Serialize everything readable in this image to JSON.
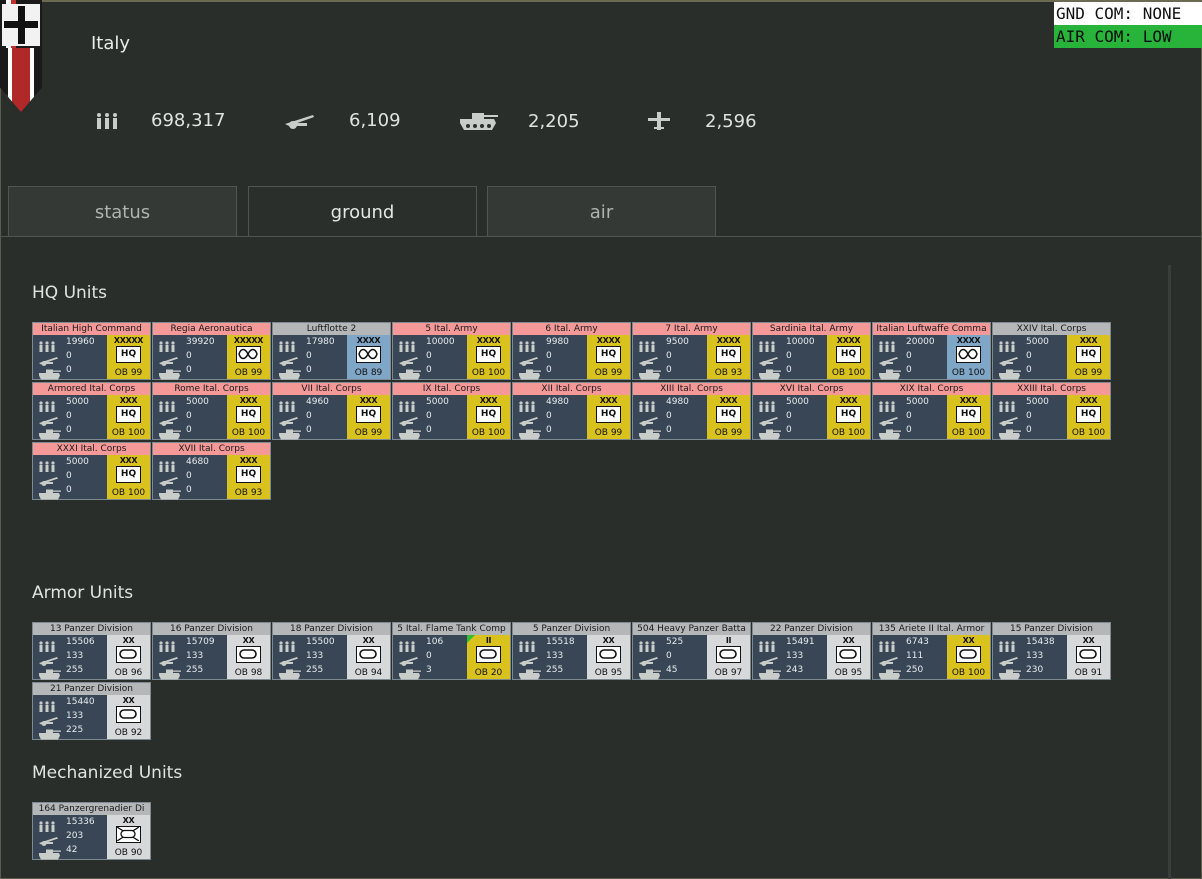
{
  "nation": "Italy",
  "command": {
    "gnd": "GND COM: NONE",
    "air": "AIR COM: LOW"
  },
  "stats": {
    "men": "698,317",
    "guns": "6,109",
    "tanks": "2,205",
    "aircraft": "2,596"
  },
  "tabs": [
    "status",
    "ground",
    "air"
  ],
  "active_tab": "ground",
  "colors": {
    "pink": "#f59898",
    "gray": "#b4b6b8",
    "yellow": "#d9c21e",
    "blue": "#7fa6c6",
    "white": "#d6d8da",
    "air_com": "#28b43a"
  },
  "sections": {
    "hq": {
      "title": "HQ Units",
      "units": [
        {
          "name": "Italian High Command",
          "men": "19960",
          "guns": "0",
          "tanks": "0",
          "echelon": "XXXXX",
          "sym": "HQ",
          "ob": "OB 99",
          "head": "pink",
          "badge": "yellow"
        },
        {
          "name": "Regia Aeronautica",
          "men": "39920",
          "guns": "0",
          "tanks": "0",
          "echelon": "XXXXX",
          "sym": "air",
          "ob": "OB 99",
          "head": "pink",
          "badge": "yellow"
        },
        {
          "name": "Luftflotte 2",
          "men": "17980",
          "guns": "0",
          "tanks": "0",
          "echelon": "XXXX",
          "sym": "air",
          "ob": "OB 89",
          "head": "gray",
          "badge": "blue"
        },
        {
          "name": "5 Ital. Army",
          "men": "10000",
          "guns": "0",
          "tanks": "0",
          "echelon": "XXXX",
          "sym": "HQ",
          "ob": "OB 100",
          "head": "pink",
          "badge": "yellow"
        },
        {
          "name": "6 Ital. Army",
          "men": "9980",
          "guns": "0",
          "tanks": "0",
          "echelon": "XXXX",
          "sym": "HQ",
          "ob": "OB 99",
          "head": "pink",
          "badge": "yellow"
        },
        {
          "name": "7 Ital. Army",
          "men": "9500",
          "guns": "0",
          "tanks": "0",
          "echelon": "XXXX",
          "sym": "HQ",
          "ob": "OB 93",
          "head": "pink",
          "badge": "yellow"
        },
        {
          "name": "Sardinia Ital. Army",
          "men": "10000",
          "guns": "0",
          "tanks": "0",
          "echelon": "XXXX",
          "sym": "HQ",
          "ob": "OB 100",
          "head": "pink",
          "badge": "yellow"
        },
        {
          "name": "Italian Luftwaffe Comma",
          "men": "20000",
          "guns": "0",
          "tanks": "0",
          "echelon": "XXXX",
          "sym": "air",
          "ob": "OB 100",
          "head": "pink",
          "badge": "blue"
        },
        {
          "name": "XXIV Ital. Corps",
          "men": "5000",
          "guns": "0",
          "tanks": "0",
          "echelon": "XXX",
          "sym": "HQ",
          "ob": "OB 99",
          "head": "gray",
          "badge": "yellow"
        },
        {
          "name": "Armored Ital. Corps",
          "men": "5000",
          "guns": "0",
          "tanks": "0",
          "echelon": "XXX",
          "sym": "HQ",
          "ob": "OB 100",
          "head": "pink",
          "badge": "yellow"
        },
        {
          "name": "Rome Ital. Corps",
          "men": "5000",
          "guns": "0",
          "tanks": "0",
          "echelon": "XXX",
          "sym": "HQ",
          "ob": "OB 100",
          "head": "pink",
          "badge": "yellow"
        },
        {
          "name": "VII Ital. Corps",
          "men": "4960",
          "guns": "0",
          "tanks": "0",
          "echelon": "XXX",
          "sym": "HQ",
          "ob": "OB 99",
          "head": "pink",
          "badge": "yellow"
        },
        {
          "name": "IX Ital. Corps",
          "men": "5000",
          "guns": "0",
          "tanks": "0",
          "echelon": "XXX",
          "sym": "HQ",
          "ob": "OB 100",
          "head": "pink",
          "badge": "yellow"
        },
        {
          "name": "XII Ital. Corps",
          "men": "4980",
          "guns": "0",
          "tanks": "0",
          "echelon": "XXX",
          "sym": "HQ",
          "ob": "OB 99",
          "head": "pink",
          "badge": "yellow"
        },
        {
          "name": "XIII Ital. Corps",
          "men": "4980",
          "guns": "0",
          "tanks": "0",
          "echelon": "XXX",
          "sym": "HQ",
          "ob": "OB 99",
          "head": "pink",
          "badge": "yellow"
        },
        {
          "name": "XVI Ital. Corps",
          "men": "5000",
          "guns": "0",
          "tanks": "0",
          "echelon": "XXX",
          "sym": "HQ",
          "ob": "OB 100",
          "head": "pink",
          "badge": "yellow"
        },
        {
          "name": "XIX Ital. Corps",
          "men": "5000",
          "guns": "0",
          "tanks": "0",
          "echelon": "XXX",
          "sym": "HQ",
          "ob": "OB 100",
          "head": "pink",
          "badge": "yellow"
        },
        {
          "name": "XXIII Ital. Corps",
          "men": "5000",
          "guns": "0",
          "tanks": "0",
          "echelon": "XXX",
          "sym": "HQ",
          "ob": "OB 100",
          "head": "pink",
          "badge": "yellow"
        },
        {
          "name": "XXXI Ital. Corps",
          "men": "5000",
          "guns": "0",
          "tanks": "0",
          "echelon": "XXX",
          "sym": "HQ",
          "ob": "OB 100",
          "head": "pink",
          "badge": "yellow"
        },
        {
          "name": "XVII Ital. Corps",
          "men": "4680",
          "guns": "0",
          "tanks": "0",
          "echelon": "XXX",
          "sym": "HQ",
          "ob": "OB 93",
          "head": "pink",
          "badge": "yellow"
        }
      ]
    },
    "armor": {
      "title": "Armor Units",
      "units": [
        {
          "name": "13 Panzer Division",
          "men": "15506",
          "guns": "133",
          "tanks": "255",
          "echelon": "XX",
          "sym": "armor",
          "ob": "OB 96",
          "head": "gray",
          "badge": "white"
        },
        {
          "name": "16 Panzer Division",
          "men": "15709",
          "guns": "133",
          "tanks": "255",
          "echelon": "XX",
          "sym": "armor",
          "ob": "OB 98",
          "head": "gray",
          "badge": "white"
        },
        {
          "name": "18 Panzer Division",
          "men": "15500",
          "guns": "133",
          "tanks": "255",
          "echelon": "XX",
          "sym": "armor",
          "ob": "OB 94",
          "head": "gray",
          "badge": "white"
        },
        {
          "name": "5 Ital. Flame Tank Comp",
          "men": "106",
          "guns": "0",
          "tanks": "3",
          "echelon": "II",
          "sym": "armor",
          "ob": "OB 20",
          "head": "gray",
          "badge": "yellow",
          "flag": true
        },
        {
          "name": "5 Panzer Division",
          "men": "15518",
          "guns": "133",
          "tanks": "255",
          "echelon": "XX",
          "sym": "armor",
          "ob": "OB 95",
          "head": "gray",
          "badge": "white"
        },
        {
          "name": "504 Heavy Panzer Batta",
          "men": "525",
          "guns": "0",
          "tanks": "45",
          "echelon": "II",
          "sym": "armor",
          "ob": "OB 97",
          "head": "gray",
          "badge": "white"
        },
        {
          "name": "22 Panzer Division",
          "men": "15491",
          "guns": "133",
          "tanks": "243",
          "echelon": "XX",
          "sym": "armor",
          "ob": "OB 95",
          "head": "gray",
          "badge": "white"
        },
        {
          "name": "135 Ariete II Ital. Armor",
          "men": "6743",
          "guns": "111",
          "tanks": "250",
          "echelon": "XX",
          "sym": "armor",
          "ob": "OB 100",
          "head": "gray",
          "badge": "yellow"
        },
        {
          "name": "15 Panzer Division",
          "men": "15438",
          "guns": "133",
          "tanks": "230",
          "echelon": "XX",
          "sym": "armor",
          "ob": "OB 91",
          "head": "gray",
          "badge": "white"
        },
        {
          "name": "21 Panzer Division",
          "men": "15440",
          "guns": "133",
          "tanks": "225",
          "echelon": "XX",
          "sym": "armor",
          "ob": "OB 92",
          "head": "gray",
          "badge": "white"
        }
      ]
    },
    "mech": {
      "title": "Mechanized Units",
      "units": [
        {
          "name": "164 Panzergrenadier Di",
          "men": "15336",
          "guns": "203",
          "tanks": "42",
          "echelon": "XX",
          "sym": "mech",
          "ob": "OB 90",
          "head": "gray",
          "badge": "white"
        }
      ]
    }
  }
}
